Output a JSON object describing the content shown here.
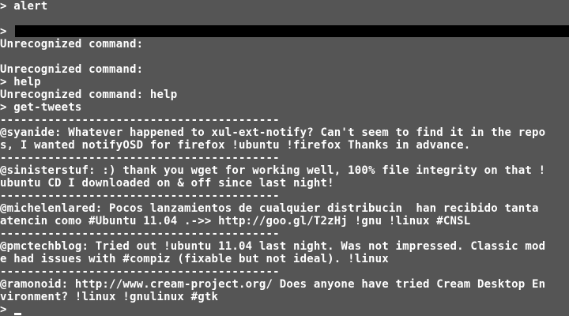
{
  "terminal": {
    "prompt": ">",
    "lines": [
      "> alert",
      "",
      ">",
      "Unrecognized command:",
      "",
      "Unrecognized command:",
      "> help",
      "Unrecognized command: help",
      "> get-tweets",
      "-----------------------------------------",
      "@syanide: Whatever happened to xul-ext-notify? Can't seem to find it in the repo",
      "s, I wanted notifyOSD for firefox !ubuntu !firefox Thanks in advance.",
      "-----------------------------------------",
      "@sinisterstuf: :) thank you wget for working well, 100% file integrity on that !",
      "ubuntu CD I downloaded on & off since last night!",
      "-----------------------------------------",
      "@michelenlared: Pocos lanzamientos de cualquier distribucin  han recibido tanta",
      "atencin como #Ubuntu 11.04 .->> http://goo.gl/T2zHj !gnu !linux #CNSL",
      "-----------------------------------------",
      "@pmctechblog: Tried out !ubuntu 11.04 last night. Was not impressed. Classic mod",
      "e had issues with #compiz (fixable but not ideal). !linux",
      "-----------------------------------------",
      "@ramonoid: http://www.cream-project.org/ Does anyone have tried Cream Desktop En",
      "vironment? !linux !gnulinux #gtk",
      ">"
    ]
  },
  "colors": {
    "background": "#555555",
    "foreground": "#ffffff",
    "selection": "#000000"
  }
}
